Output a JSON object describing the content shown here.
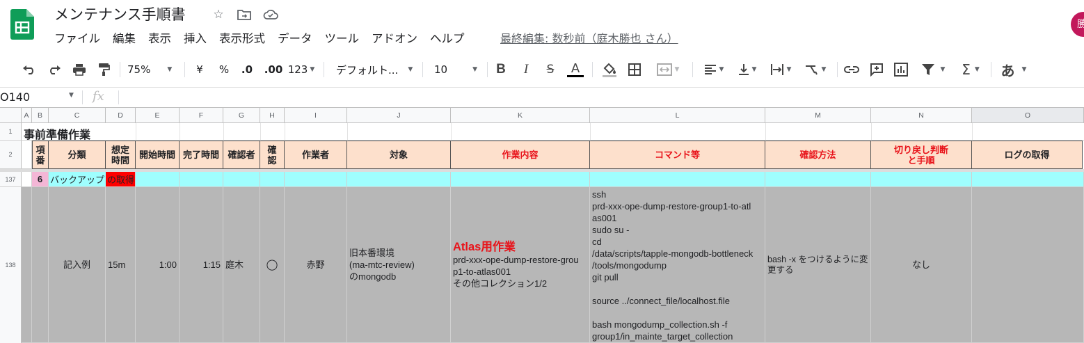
{
  "doc": {
    "title": "メンテナンス手順書",
    "menu": [
      "ファイル",
      "編集",
      "表示",
      "挿入",
      "表示形式",
      "データ",
      "ツール",
      "アドオン",
      "ヘルプ"
    ],
    "last_edit": "最終編集: 数秒前（庭木勝也 さん）",
    "avatar": "勝"
  },
  "toolbar": {
    "zoom": "75%",
    "currency": "¥",
    "percent": "%",
    "dec_decrease": ".0",
    "dec_increase": ".00",
    "format_more": "123",
    "font": "デフォルト...",
    "font_size": "10",
    "bold": "B",
    "italic": "I",
    "strike": "S",
    "text_color": "A",
    "input_tools": "あ"
  },
  "formula_bar": {
    "name_box": "O140",
    "fx": "fx",
    "value": ""
  },
  "grid": {
    "columns": [
      "A",
      "B",
      "C",
      "D",
      "E",
      "F",
      "G",
      "H",
      "I",
      "J",
      "K",
      "L",
      "M",
      "N",
      "O"
    ],
    "row_numbers": [
      "1",
      "2",
      "137",
      "138"
    ],
    "section_title": "事前準備作業",
    "headers": {
      "b": "項\n番",
      "c": "分類",
      "d": "想定\n時間",
      "e": "開始時間",
      "f": "完了時間",
      "g": "確認者",
      "h": "確\n認",
      "i": "作業者",
      "j": "対象",
      "k": "作業内容",
      "l": "コマンド等",
      "m": "確認方法",
      "n": "切り戻し判断\nと手順",
      "o": "ログの取得"
    },
    "row137": {
      "num": "6",
      "category": "バックアップ",
      "tag": "の取得"
    },
    "row138": {
      "category": "記入例",
      "est_time": "15m",
      "start": "1:00",
      "end": "1:15",
      "checker": "庭木",
      "confirm": "◯",
      "worker": "赤野",
      "target": "旧本番環境\n(ma-mtc-review)\nのmongodb",
      "work_title": "Atlas用作業",
      "work_body": "prd-xxx-ope-dump-restore-grou\np1-to-atlas001\nその他コレクション1/2",
      "command": "ssh\nprd-xxx-ope-dump-restore-group1-to-atl\nas001\nsudo su -\ncd\n/data/scripts/tapple-mongodb-bottleneck\n/tools/mongodump\ngit pull\n\nsource ../connect_file/localhost.file\n\nbash mongodump_collection.sh -f\ngroup1/in_mainte_target_collection",
      "verify": "bash -x をつけるように変\n更する",
      "rollback": "なし",
      "log": ""
    }
  }
}
